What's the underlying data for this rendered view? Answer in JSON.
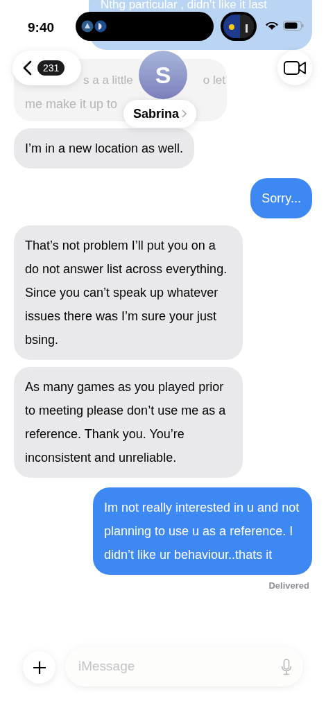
{
  "status_bar": {
    "time": "9:40"
  },
  "header": {
    "back_badge": "231",
    "avatar_initial": "S",
    "contact_name": "Sabrina"
  },
  "messages": [
    {
      "kind": "partial_sent",
      "text": "Nthg particular , didn’t like it last"
    },
    {
      "kind": "partial_received",
      "fragments": [
        "s a a little",
        "o let",
        "me make it up to"
      ]
    },
    {
      "kind": "received",
      "text": "I’m in a new location as well."
    },
    {
      "kind": "sent",
      "text": "Sorry..."
    },
    {
      "kind": "received",
      "text": "That’s not problem I’ll put you on a do not answer list across everything. Since you can’t speak up whatever issues there was I’m sure your just bsing."
    },
    {
      "kind": "received",
      "text": "As many games as you played prior to meeting please don’t use me as a reference. Thank you. You’re inconsistent and unreliable."
    },
    {
      "kind": "sent",
      "text": "Im not really interested in u and not planning to use u as a reference. I didn’t like ur behaviour..thats it"
    }
  ],
  "delivery_status": "Delivered",
  "composer": {
    "placeholder": "iMessage"
  }
}
